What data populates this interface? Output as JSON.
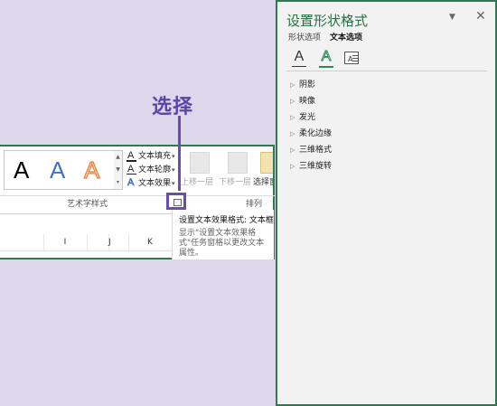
{
  "ribbon": {
    "gallery": {
      "samples": [
        "A",
        "A",
        "A"
      ],
      "scroll": [
        "▲",
        "▼",
        "▾"
      ]
    },
    "text_format": {
      "fill_label": "文本填充",
      "outline_label": "文本轮廓",
      "effects_label": "文本效果",
      "dropdown": "▾"
    },
    "arrange": {
      "bring_forward": "上移一层",
      "send_backward": "下移一层",
      "selection_pane": "选择窗"
    },
    "groups": {
      "wordart_styles": "艺术字样式",
      "arrange": "排列"
    },
    "columns": [
      "I",
      "J",
      "K"
    ]
  },
  "tooltip": {
    "title": "设置文本效果格式: 文本框",
    "body": "显示\"设置文本效果格式\"任务窗格以更改文本属性。"
  },
  "annotation": {
    "label": "选择"
  },
  "pane": {
    "title": "设置形状格式",
    "pin": "▼",
    "close": "✕",
    "tabs": {
      "shape": "形状选项",
      "text": "文本选项"
    },
    "icons": {
      "fill": "text-fill-outline-icon",
      "effects": "text-effects-icon",
      "textbox": "text-box-icon"
    },
    "sections": [
      "阴影",
      "映像",
      "发光",
      "柔化边缘",
      "三维格式",
      "三维旋转"
    ]
  },
  "colors": {
    "accent_green": "#2f7a4d",
    "annotation_purple": "#6a4cae",
    "background": "#dcd7ea"
  }
}
